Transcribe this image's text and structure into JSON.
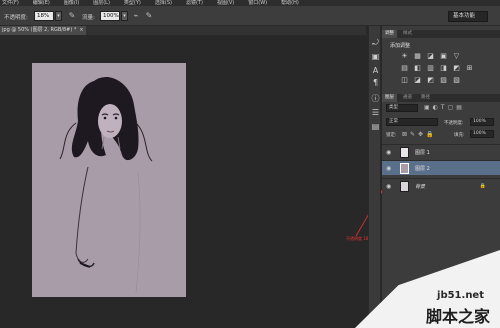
{
  "menubar": {
    "items": [
      "文件(F)",
      "编辑(E)",
      "图像(I)",
      "图层(L)",
      "类型(Y)",
      "选择(S)",
      "滤镜(T)",
      "视图(V)",
      "窗口(W)",
      "帮助(H)"
    ]
  },
  "options": {
    "opacity_label": "不透明度:",
    "opacity_value": "18%",
    "flow_label": "流量:",
    "flow_value": "100%",
    "workspace": "基本功能"
  },
  "document_tab": {
    "title": "jpg @ 50% (图层 2, RGB/8#) *",
    "close": "×"
  },
  "adjustments_panel": {
    "tabs": [
      "调整",
      "样式"
    ],
    "title": "添加调整",
    "row1_icons": [
      "☀",
      "▦",
      "◪",
      "▣",
      "▽"
    ],
    "row2_icons": [
      "▤",
      "◧",
      "▥",
      "◨",
      "◩",
      "⊞"
    ],
    "row3_icons": [
      "◫",
      "◪",
      "◩",
      "▨",
      "▧"
    ]
  },
  "layers_panel": {
    "tabs": [
      "图层",
      "通道",
      "路径"
    ],
    "kind_label": "类型",
    "blend_mode": "正常",
    "opacity_label": "不透明度:",
    "opacity_value": "100%",
    "lock_label": "锁定:",
    "fill_label": "填充:",
    "fill_value": "100%",
    "layers": [
      {
        "name": "图层 1",
        "selected": false
      },
      {
        "name": "图层 2",
        "selected": true
      },
      {
        "name": "背景",
        "selected": false,
        "locked": true
      }
    ]
  },
  "annotation": {
    "text": "不透明度 18%"
  },
  "watermark": {
    "line1": "jb51.net",
    "line2": "脚本之家"
  },
  "colors": {
    "canvas_photo": "#a99ca9",
    "selected_layer": "#5a6f89",
    "panel": "#3c3c3c"
  }
}
